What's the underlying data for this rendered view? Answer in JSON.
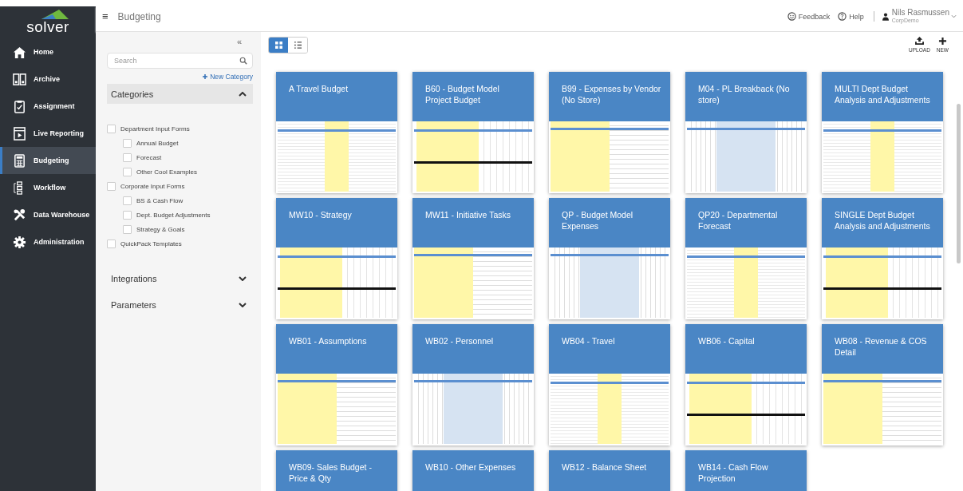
{
  "logo": {
    "text": "solver"
  },
  "sidebar": {
    "items": [
      {
        "label": "Home",
        "selected": false
      },
      {
        "label": "Archive",
        "selected": false
      },
      {
        "label": "Assignment",
        "selected": false
      },
      {
        "label": "Live Reporting",
        "selected": false
      },
      {
        "label": "Budgeting",
        "selected": true
      },
      {
        "label": "Workflow",
        "selected": false
      },
      {
        "label": "Data Warehouse",
        "selected": false
      },
      {
        "label": "Administration",
        "selected": false
      }
    ]
  },
  "header": {
    "menu": "≡",
    "title": "Budgeting",
    "feedback": "Feedback",
    "help": "Help",
    "user": {
      "name": "Nils Rasmussen",
      "company": "CorpDemo"
    }
  },
  "filter_panel": {
    "collapse": "«",
    "search": {
      "placeholder": "Search"
    },
    "new_category": "New Category",
    "sections": [
      {
        "title": "Categories",
        "expanded": true,
        "items": [
          {
            "label": "Department Input Forms",
            "checked": false,
            "children": [
              {
                "label": "Annual Budget",
                "checked": false
              },
              {
                "label": "Forecast",
                "checked": false
              },
              {
                "label": "Other Cool Examples",
                "checked": false
              }
            ]
          },
          {
            "label": "Corporate Input Forms",
            "checked": false,
            "children": [
              {
                "label": "BS & Cash Flow",
                "checked": false
              },
              {
                "label": "Dept. Budget Adjustments",
                "checked": false
              },
              {
                "label": "Strategy & Goals",
                "checked": false
              }
            ]
          },
          {
            "label": "QuickPack Templates",
            "checked": false
          }
        ]
      },
      {
        "title": "Integrations",
        "expanded": false
      },
      {
        "title": "Parameters",
        "expanded": false
      }
    ]
  },
  "toolbar": {
    "views": [
      {
        "kind": "grid",
        "selected": true
      },
      {
        "kind": "list",
        "selected": false
      }
    ],
    "actions": [
      {
        "kind": "upload",
        "label": "UPLOAD"
      },
      {
        "kind": "new",
        "label": "NEW"
      }
    ]
  },
  "templates": [
    {
      "title": "A Travel Budget"
    },
    {
      "title": "B60 - Budget Model Project Budget"
    },
    {
      "title": "B99 - Expenses by Vendor (No Store)"
    },
    {
      "title": "M04 - PL Breakback (No store)"
    },
    {
      "title": "MULTI Dept Budget Analysis and Adjustments"
    },
    {
      "title": "MW10 - Strategy"
    },
    {
      "title": "MW11 - Initiative Tasks"
    },
    {
      "title": "QP - Budget Model Expenses"
    },
    {
      "title": "QP20 - Departmental Forecast"
    },
    {
      "title": "SINGLE Dept Budget Analysis and Adjustments"
    },
    {
      "title": "WB01 - Assumptions"
    },
    {
      "title": "WB02 - Personnel"
    },
    {
      "title": "WB04 - Travel"
    },
    {
      "title": "WB06 - Capital"
    },
    {
      "title": "WB08 - Revenue & COS Detail"
    },
    {
      "title": "WB09- Sales Budget - Price & Qty"
    },
    {
      "title": "WB10 - Other Expenses"
    },
    {
      "title": "WB12 - Balance Sheet"
    },
    {
      "title": "WB14 - Cash Flow Projection"
    }
  ]
}
